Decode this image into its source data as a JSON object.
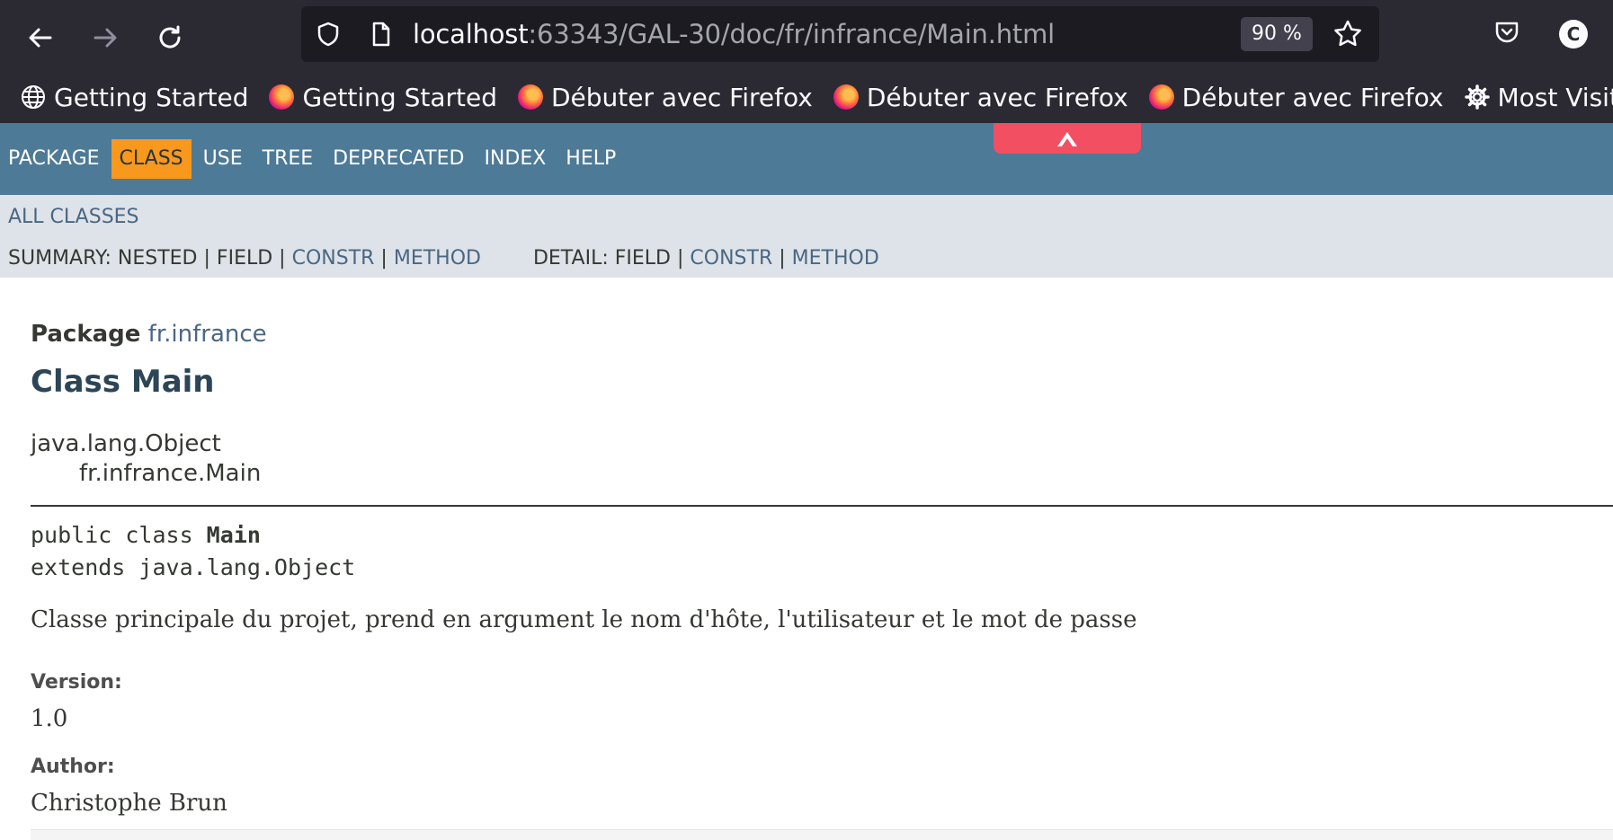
{
  "browser": {
    "url_host": "localhost",
    "url_path": ":63343/GAL-30/doc/fr/infrance/Main.html",
    "zoom": "90 %",
    "account_initial": "C",
    "bookmarks": [
      {
        "label": "Getting Started",
        "icon": "globe-icon"
      },
      {
        "label": "Getting Started",
        "icon": "firefox-icon"
      },
      {
        "label": "Débuter avec Firefox",
        "icon": "firefox-icon"
      },
      {
        "label": "Débuter avec Firefox",
        "icon": "firefox-icon"
      },
      {
        "label": "Débuter avec Firefox",
        "icon": "firefox-icon"
      },
      {
        "label": "Most Visited",
        "icon": "gear-icon"
      }
    ]
  },
  "topnav": {
    "items": [
      "PACKAGE",
      "CLASS",
      "USE",
      "TREE",
      "DEPRECATED",
      "INDEX",
      "HELP"
    ],
    "active": "CLASS"
  },
  "subnav": {
    "all_classes": "ALL CLASSES",
    "summary_label": "SUMMARY:",
    "summary_nested": "NESTED",
    "summary_field": "FIELD",
    "summary_constr": "CONSTR",
    "summary_method": "METHOD",
    "detail_label": "DETAIL:",
    "detail_field": "FIELD",
    "detail_constr": "CONSTR",
    "detail_method": "METHOD",
    "separator": "|"
  },
  "page": {
    "package_label": "Package",
    "package_name": "fr.infrance",
    "class_title": "Class Main",
    "inheritance_root": "java.lang.Object",
    "inheritance_child": "fr.infrance.Main",
    "signature_prefix": "public class ",
    "signature_name": "Main",
    "signature_extends": "extends java.lang.Object",
    "description": "Classe principale du projet, prend en argument le nom d'hôte, l'utilisateur et le mot de passe",
    "version_label": "Version:",
    "version_value": "1.0",
    "author_label": "Author:",
    "author_value": "Christophe Brun"
  },
  "colors": {
    "chrome_bg": "#2b2a33",
    "urlbar_bg": "#1c1b22",
    "topnav_bg": "#4d7a97",
    "active_tab_bg": "#f8981d",
    "subnav_bg": "#dee3e9",
    "link": "#4a6782",
    "title": "#2c4557"
  }
}
